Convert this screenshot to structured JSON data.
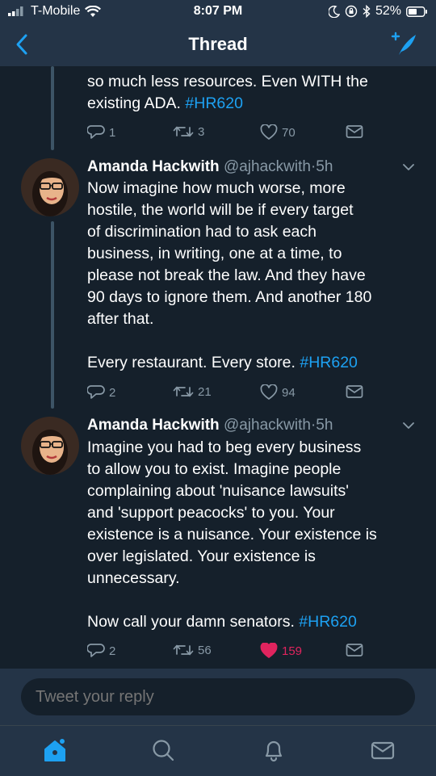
{
  "status": {
    "carrier": "T-Mobile",
    "time": "8:07 PM",
    "battery": "52%",
    "icons": [
      "signal-icon",
      "wifi-icon",
      "moon-icon",
      "lock-rotation-icon",
      "bluetooth-icon",
      "battery-icon"
    ]
  },
  "nav": {
    "title": "Thread"
  },
  "tweets": [
    {
      "text": "so much less resources. Even WITH the\nexisting ADA.",
      "hashtag": "#HR620",
      "replies": "1",
      "retweets": "3",
      "likes": "70",
      "liked": false
    },
    {
      "name": "Amanda Hackwith",
      "handle": "@ajhackwith",
      "sep": "·",
      "time": "5h",
      "text": "Now imagine how much worse, more\nhostile, the world will be if every target\nof discrimination had to ask each\nbusiness, in writing, one at a time, to\nplease not break the law. And they have\n90 days to ignore them. And another 180\nafter that.\n\nEvery restaurant. Every store.",
      "hashtag": "#HR620",
      "replies": "2",
      "retweets": "21",
      "likes": "94",
      "liked": false
    },
    {
      "name": "Amanda Hackwith",
      "handle": "@ajhackwith",
      "sep": "·",
      "time": "5h",
      "text": "Imagine you had to beg every business\nto allow you to exist. Imagine people\ncomplaining about 'nuisance lawsuits'\nand 'support peacocks' to you. Your\nexistence is a nuisance. Your existence is\nover legislated. Your existence is\nunnecessary.\n\nNow call your damn senators.",
      "hashtag": "#HR620",
      "replies": "2",
      "retweets": "56",
      "likes": "159",
      "liked": true
    }
  ],
  "reply": {
    "placeholder": "Tweet your reply"
  },
  "tabs": [
    "home-icon",
    "search-icon",
    "notifications-icon",
    "messages-icon"
  ],
  "colors": {
    "accent": "#1da1f2",
    "like": "#e0245e",
    "bg": "#15202b",
    "bar": "#243447",
    "muted": "#8899a6"
  }
}
